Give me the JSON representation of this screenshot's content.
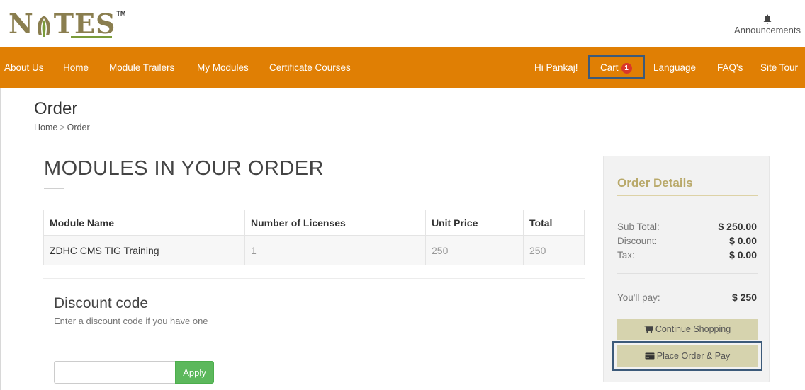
{
  "brand": {
    "logo_text_left": "N",
    "logo_text_right": "TES",
    "logo_tm": "TM"
  },
  "header": {
    "announcements_label": "Announcements"
  },
  "nav": {
    "left_items": [
      "About Us",
      "Home",
      "Module Trailers",
      "My Modules",
      "Certificate Courses"
    ],
    "greeting": "Hi Pankaj!",
    "cart_label": "Cart",
    "cart_count": "1",
    "right_items": [
      "Language",
      "FAQ's",
      "Site Tour"
    ]
  },
  "page": {
    "title": "Order",
    "breadcrumb": [
      "Home",
      "Order"
    ],
    "breadcrumb_sep": ">"
  },
  "modules": {
    "heading": "MODULES IN YOUR ORDER",
    "columns": [
      "Module Name",
      "Number of Licenses",
      "Unit Price",
      "Total"
    ],
    "rows": [
      [
        "ZDHC CMS TIG Training",
        "1",
        "250",
        "250"
      ]
    ]
  },
  "discount": {
    "title": "Discount code",
    "description": "Enter a discount code if you have one",
    "input_value": "",
    "apply_label": "Apply"
  },
  "order_details": {
    "title": "Order Details",
    "sub_total_label": "Sub Total:",
    "sub_total_value": "$ 250.00",
    "discount_label": "Discount:",
    "discount_value": "$ 0.00",
    "tax_label": "Tax:",
    "tax_value": "$ 0.00",
    "pay_label": "You'll pay:",
    "pay_value": "$ 250",
    "continue_label": "Continue Shopping",
    "place_order_label": "Place Order & Pay"
  },
  "colors": {
    "nav_bg": "#e07f04",
    "highlight_outline": "#3c5a7a",
    "badge": "#d9372a",
    "apply_button": "#5cb85c",
    "panel_button": "#d6d3ae",
    "panel_title": "#b9a96a"
  },
  "icons": {
    "bell": "bell-icon",
    "cart": "cart-icon",
    "card": "credit-card-icon",
    "leaf": "leaf-icon"
  }
}
